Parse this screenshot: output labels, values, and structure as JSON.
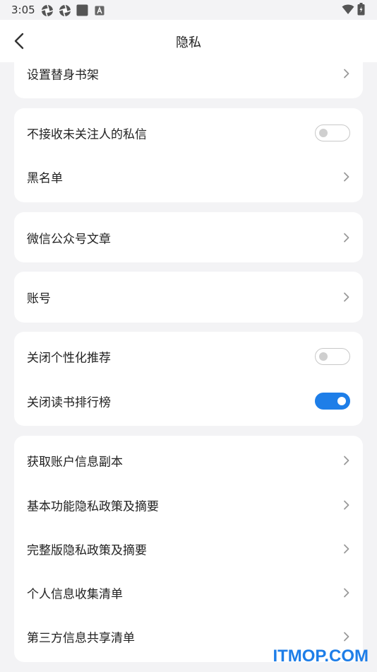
{
  "statusbar": {
    "time": "3:05",
    "icons_left": [
      "aperture-icon",
      "aperture-icon",
      "square-app-icon",
      "letter-a-icon"
    ],
    "icons_right": [
      "wifi-icon",
      "battery-icon"
    ]
  },
  "header": {
    "title": "隐私",
    "back_icon": "chevron-left-icon"
  },
  "cards": [
    {
      "rows": [
        {
          "label": "设置替身书架",
          "control": "chevron"
        }
      ]
    },
    {
      "rows": [
        {
          "label": "不接收未关注人的私信",
          "control": "toggle",
          "state": "off"
        },
        {
          "label": "黑名单",
          "control": "chevron"
        }
      ]
    },
    {
      "rows": [
        {
          "label": "微信公众号文章",
          "control": "chevron"
        }
      ]
    },
    {
      "rows": [
        {
          "label": "账号",
          "control": "chevron"
        }
      ]
    },
    {
      "rows": [
        {
          "label": "关闭个性化推荐",
          "control": "toggle",
          "state": "off"
        },
        {
          "label": "关闭读书排行榜",
          "control": "toggle",
          "state": "on"
        }
      ]
    },
    {
      "rows": [
        {
          "label": "获取账户信息副本",
          "control": "chevron"
        },
        {
          "label": "基本功能隐私政策及摘要",
          "control": "chevron"
        },
        {
          "label": "完整版隐私政策及摘要",
          "control": "chevron"
        },
        {
          "label": "个人信息收集清单",
          "control": "chevron"
        },
        {
          "label": "第三方信息共享清单",
          "control": "chevron"
        }
      ]
    }
  ],
  "watermark": "ITMOP.COM",
  "colors": {
    "background": "#f3f3f5",
    "card": "#ffffff",
    "accent": "#1e7ee8",
    "toggle_off_border": "#c8c8c8"
  }
}
